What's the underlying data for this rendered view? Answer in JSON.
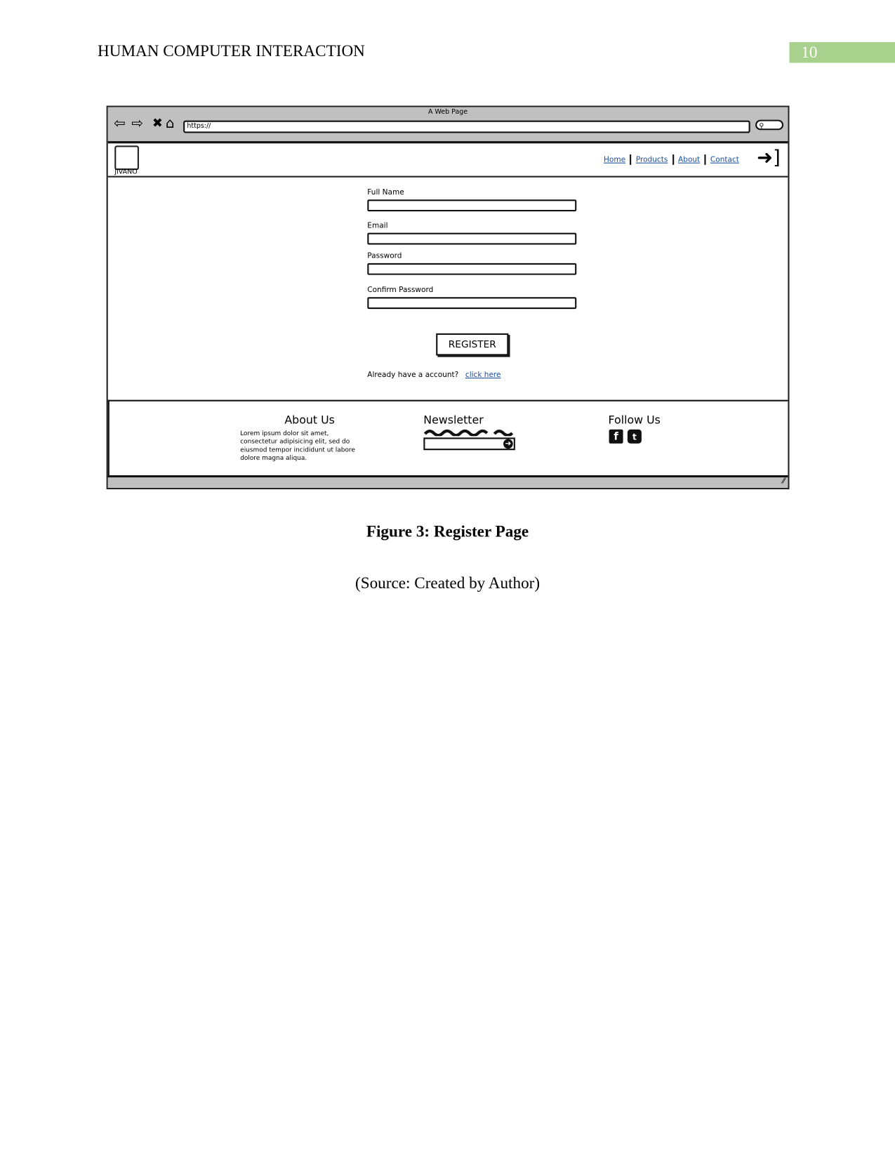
{
  "document": {
    "header": "HUMAN COMPUTER INTERACTION",
    "page_number": "10",
    "page_number_color": "#a9d18e",
    "caption": "Figure 3: Register Page",
    "source": "(Source: Created by Author)"
  },
  "wireframe": {
    "browser": {
      "title": "A Web Page",
      "url": "https://",
      "icons": [
        "back-arrow-icon",
        "forward-arrow-icon",
        "close-icon",
        "home-icon",
        "search-icon"
      ]
    },
    "site": {
      "logo_text": "JIVANO",
      "nav": [
        {
          "label": "Home"
        },
        {
          "label": "Products"
        },
        {
          "label": "About"
        },
        {
          "label": "Contact"
        }
      ],
      "login_icon": "sign-in-icon",
      "link_color": "#1a4f9c"
    },
    "form": {
      "fields": [
        {
          "label": "Full Name",
          "value": ""
        },
        {
          "label": "Email",
          "value": ""
        },
        {
          "label": "Password",
          "value": ""
        },
        {
          "label": "Confirm Password",
          "value": ""
        }
      ],
      "submit_label": "REGISTER",
      "login_prompt": "Already have a account?",
      "login_link": "click here"
    },
    "footer": {
      "about_title": "About Us",
      "about_text": "Lorem ipsum dolor sit amet, consectetur adipisicing elit, sed do eiusmod tempor incididunt ut labore dolore magna aliqua.",
      "newsletter_title": "Newsletter",
      "follow_title": "Follow Us",
      "social_icons": [
        "facebook-icon",
        "twitter-icon"
      ]
    }
  }
}
